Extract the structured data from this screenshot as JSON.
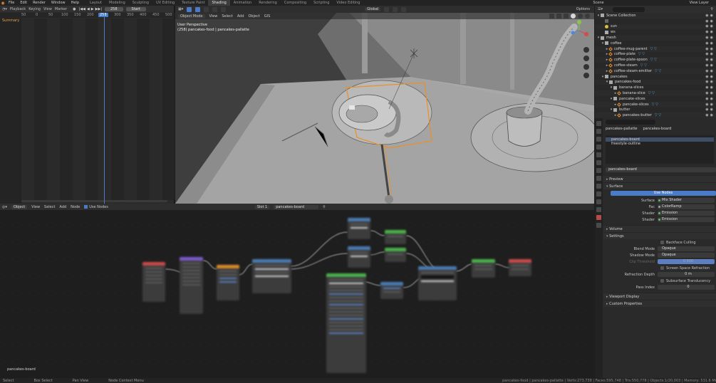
{
  "topbar": {
    "menus": [
      "File",
      "Edit",
      "Render",
      "Window",
      "Help"
    ],
    "workspaces": [
      "Layout",
      "Modeling",
      "Sculpting",
      "UV Editing",
      "Texture Paint",
      "Shading",
      "Animation",
      "Rendering",
      "Compositing",
      "Scripting",
      "Video Editing"
    ],
    "active_workspace": "Shading",
    "scene": "Scene",
    "view_layer": "View Layer"
  },
  "dopesheet": {
    "playback": "Playback",
    "keying": "Keying",
    "view": "View",
    "marker": "Marker",
    "current_frame": "258",
    "start_label": "Start",
    "ticks": [
      "50",
      "0",
      "50",
      "100",
      "150",
      "200",
      "300",
      "350",
      "400",
      "450",
      "500"
    ],
    "ruler_current": "258",
    "summary": "Summary"
  },
  "viewport": {
    "mode": "Object Mode",
    "menus": [
      "View",
      "Select",
      "Add",
      "Object",
      "GIS"
    ],
    "orientation": "Global",
    "options": "Options",
    "info_line1": "User Perspective",
    "info_line2": "(258) pancakes-food | pancakes-pallatte"
  },
  "nodeeditor": {
    "type": "Object",
    "menus": [
      "View",
      "Select",
      "Add",
      "Node"
    ],
    "use_nodes": "Use Nodes",
    "slot": "Slot 1",
    "material": "pancakes-board",
    "bottom_label": "pancakes-board"
  },
  "statusbar": {
    "items": [
      "Select",
      "Box Select",
      "Pan View",
      "Node Context Menu"
    ],
    "right": "pancakes-food | pancakes-pallatte | Verts:273,738 | Faces:595,748 | Tris:550,778 | Objects:1/20,003 | Memory: 531.6 MiB | VRAM: 1.9/8.0 GiB | 2.92"
  },
  "outliner": {
    "rows": [
      {
        "indent": 0,
        "tri": "▾",
        "icon": "coll",
        "label": "Scene Collection",
        "mods": ""
      },
      {
        "indent": 1,
        "tri": "",
        "icon": "cam",
        "label": "",
        "mods": ""
      },
      {
        "indent": 1,
        "tri": "",
        "icon": "lamp",
        "label": "sun",
        "mods": ""
      },
      {
        "indent": 1,
        "tri": "",
        "icon": "coll",
        "label": "ws",
        "mods": ""
      },
      {
        "indent": 0,
        "tri": "▾",
        "icon": "coll",
        "label": "mesh",
        "mods": ""
      },
      {
        "indent": 1,
        "tri": "▾",
        "icon": "coll",
        "label": "coffee",
        "mods": ""
      },
      {
        "indent": 2,
        "tri": "▸",
        "icon": "mesh",
        "label": "coffee-mug-parent",
        "mods": "▽ ▽"
      },
      {
        "indent": 2,
        "tri": "▸",
        "icon": "mesh",
        "label": "coffee-plate",
        "mods": "▽ ▽"
      },
      {
        "indent": 2,
        "tri": "▸",
        "icon": "mesh",
        "label": "coffee-plate-spoon",
        "mods": "▽ ▽"
      },
      {
        "indent": 2,
        "tri": "▸",
        "icon": "mesh",
        "label": "coffee-steam",
        "mods": "▽ ▽"
      },
      {
        "indent": 2,
        "tri": "▸",
        "icon": "mesh",
        "label": "coffee-steam-emitter",
        "mods": "▽ ▽"
      },
      {
        "indent": 1,
        "tri": "▾",
        "icon": "coll",
        "label": "pancakes",
        "mods": ""
      },
      {
        "indent": 2,
        "tri": "▾",
        "icon": "coll",
        "label": "pancakes-food",
        "mods": ""
      },
      {
        "indent": 3,
        "tri": "▾",
        "icon": "coll",
        "label": "banana-slices",
        "mods": ""
      },
      {
        "indent": 4,
        "tri": "▸",
        "icon": "mesh",
        "label": "banana-slice",
        "mods": "▽ ▽"
      },
      {
        "indent": 3,
        "tri": "▾",
        "icon": "coll",
        "label": "pancake-slices",
        "mods": ""
      },
      {
        "indent": 4,
        "tri": "▸",
        "icon": "mesh",
        "label": "pancake-slices",
        "mods": "▽ ▽"
      },
      {
        "indent": 3,
        "tri": "▾",
        "icon": "coll",
        "label": "butter",
        "mods": ""
      },
      {
        "indent": 4,
        "tri": "▸",
        "icon": "mesh",
        "label": "pancakes-butter",
        "mods": "▽ ▽"
      },
      {
        "indent": 3,
        "tri": "▸",
        "icon": "mesh",
        "label": "banana-large",
        "mods": "▽ ▽"
      }
    ]
  },
  "properties": {
    "object_name": "pancakes-pallatte",
    "material_name": "pancakes-board",
    "slots": [
      "pancakes-board",
      "freestyle-outline"
    ],
    "material_field": "pancakes-board",
    "panels": {
      "preview": "Preview",
      "surface": "Surface",
      "use_nodes": "Use Nodes",
      "volume": "Volume",
      "settings": "Settings",
      "viewport_display": "Viewport Display",
      "custom_properties": "Custom Properties"
    },
    "surface_rows": [
      {
        "label": "Surface",
        "value": "Mix Shader",
        "dot": "#5fbf5f"
      },
      {
        "label": "Fac",
        "value": "ColorRamp",
        "dot": "#a0a0a0"
      },
      {
        "label": "Shader",
        "value": "Emission",
        "dot": "#5fbf5f"
      },
      {
        "label": "Shader",
        "value": "Emission",
        "dot": "#5fbf5f"
      }
    ],
    "settings": {
      "backface_culling": "Backface Culling",
      "blend_mode_label": "Blend Mode",
      "blend_mode": "Opaque",
      "shadow_mode_label": "Shadow Mode",
      "shadow_mode": "Opaque",
      "clip_threshold_label": "Clip Threshold",
      "clip_threshold": "0.500",
      "ssr": "Screen Space Refraction",
      "refraction_depth_label": "Refraction Depth",
      "refraction_depth": "0 m",
      "sss": "Subsurface Translucency",
      "pass_index_label": "Pass Index",
      "pass_index": "0"
    }
  },
  "colors": {
    "accent": "#4a7bc8",
    "selection_outline": "#e8902a",
    "summary": "#e8a24a"
  }
}
